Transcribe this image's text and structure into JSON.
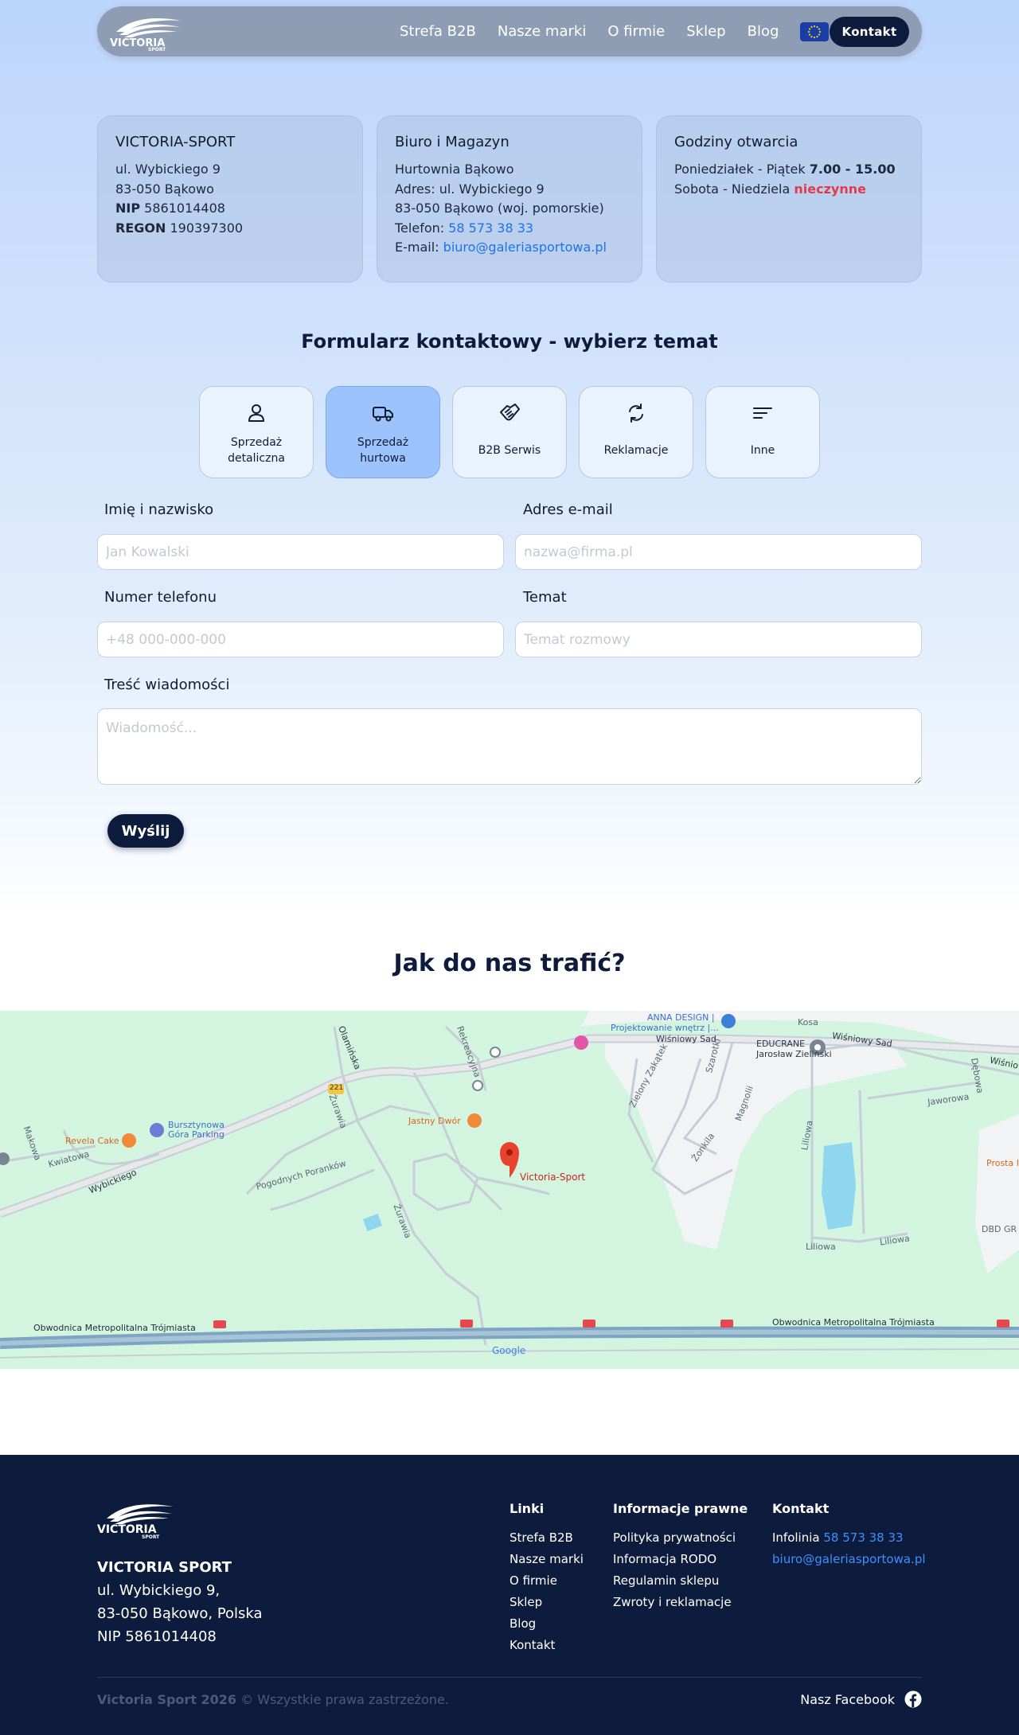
{
  "nav": {
    "logo_icon": "victoria-sport-logo",
    "links": [
      "Strefa B2B",
      "Nasze marki",
      "O firmie",
      "Sklep",
      "Blog"
    ],
    "flag_icon": "eu-flag-icon",
    "contact_label": "Kontakt"
  },
  "cards": {
    "company": {
      "title": "VICTORIA-SPORT",
      "street": "ul. Wybickiego 9",
      "city": "83-050 Bąkowo",
      "nip_label": "NIP",
      "nip": "5861014408",
      "regon_label": "REGON",
      "regon": "190397300"
    },
    "office": {
      "title": "Biuro i Magazyn",
      "line1": "Hurtownia Bąkowo",
      "line2": "Adres: ul. Wybickiego 9",
      "line3": "83-050 Bąkowo (woj. pomorskie)",
      "phone_label": "Telefon:",
      "phone": "58 573 38 33",
      "email_label": "E-mail:",
      "email": "biuro@galeriasportowa.pl"
    },
    "hours": {
      "title": "Godziny otwarcia",
      "weekdays_label": "Poniedziałek - Piątek",
      "weekdays_value": "7.00 - 15.00",
      "weekend_label": "Sobota - Niedziela",
      "weekend_value": "nieczynne"
    }
  },
  "form": {
    "title": "Formularz kontaktowy - wybierz temat",
    "topics": [
      {
        "label": "Sprzedaż detaliczna",
        "icon": "user-icon",
        "active": false
      },
      {
        "label": "Sprzedaż hurtowa",
        "icon": "truck-icon",
        "active": true
      },
      {
        "label": "B2B Serwis",
        "icon": "handshake-icon",
        "active": false
      },
      {
        "label": "Reklamacje",
        "icon": "refresh-icon",
        "active": false
      },
      {
        "label": "Inne",
        "icon": "sort-lines-icon",
        "active": false
      }
    ],
    "name_label": "Imię i nazwisko",
    "name_placeholder": "Jan Kowalski",
    "email_label": "Adres e-mail",
    "email_placeholder": "nazwa@firma.pl",
    "phone_label": "Numer telefonu",
    "phone_placeholder": "+48 000-000-000",
    "subject_label": "Temat",
    "subject_placeholder": "Temat rozmowy",
    "message_label": "Treść wiadomości",
    "message_placeholder": "Wiadomość...",
    "submit_label": "Wyślij"
  },
  "map": {
    "title": "Jak do nas trafić?",
    "labels": {
      "anna_design_1": "ANNA DESIGN |",
      "anna_design_2": "Projektowanie wnętrz |...",
      "wisniowy_sad": "Wiśniowy Sad",
      "wisniowy_sad_2": "Wiśniowy Sad",
      "wisniow": "Wiśniow",
      "educrane_1": "EDUCRANE",
      "educrane_2": "Jarosław Zieliński",
      "kosa": "Kosa",
      "jawor": "Jaworowa",
      "debowa": "Dębowa",
      "bursztynowa_1": "Bursztynowa",
      "bursztynowa_2": "Góra Parking",
      "revela": "Revela Cake",
      "makowa": "Makowa",
      "kwiatowa": "Kwiatowa",
      "wybickiego": "Wybickiego",
      "jastny": "Jastny Dwór",
      "victoria": "Victoria-Sport",
      "pogodnych": "Pogodnych Poranków",
      "zurawia": "Żurawia",
      "zurawia_2": "Żurawia",
      "olamin": "Olamińska",
      "rekreacyjna": "Rekreacyjna",
      "zielony": "Zielony Zakątek",
      "szarotki": "Szarotki",
      "magnolii": "Magnolii",
      "zonkila": "Żonkila",
      "liliowa": "Liliowa",
      "liliowa_2": "Liliowa",
      "liliowa_3": "Liliowa",
      "prosta": "Prosta I",
      "dbd": "DBD GR",
      "obwodnica_1": "Obwodnica Metropolitalna Trójmiasta",
      "obwodnica_2": "Obwodnica Metropolitalna Trójmiasta",
      "road_221": "221",
      "google": "Google"
    }
  },
  "footer": {
    "logo_icon": "victoria-sport-logo",
    "company_name": "VICTORIA SPORT",
    "street": "ul. Wybickiego 9,",
    "city": "83-050 Bąkowo, Polska",
    "nip": "NIP 5861014408",
    "links_title": "Linki",
    "links": [
      "Strefa B2B",
      "Nasze marki",
      "O firmie",
      "Sklep",
      "Blog",
      "Kontakt"
    ],
    "legal_title": "Informacje prawne",
    "legal": [
      "Polityka prywatności",
      "Informacja RODO",
      "Regulamin sklepu",
      "Zwroty i reklamacje"
    ],
    "contact_title": "Kontakt",
    "infoline_label": "Infolinia",
    "infoline": "58 573 38 33",
    "email": "biuro@galeriasportowa.pl",
    "copyright_brand": "Victoria Sport 2026",
    "copyright_text": "© Wszystkie prawa zastrzeżone.",
    "facebook_label": "Nasz Facebook",
    "facebook_icon": "facebook-icon"
  },
  "colors": {
    "navy": "#0d1b3d",
    "accent_blue": "#1f74e6",
    "active_topic": "#9cc3fb",
    "red": "#e23a4a",
    "map_green": "#d3f5e0"
  }
}
